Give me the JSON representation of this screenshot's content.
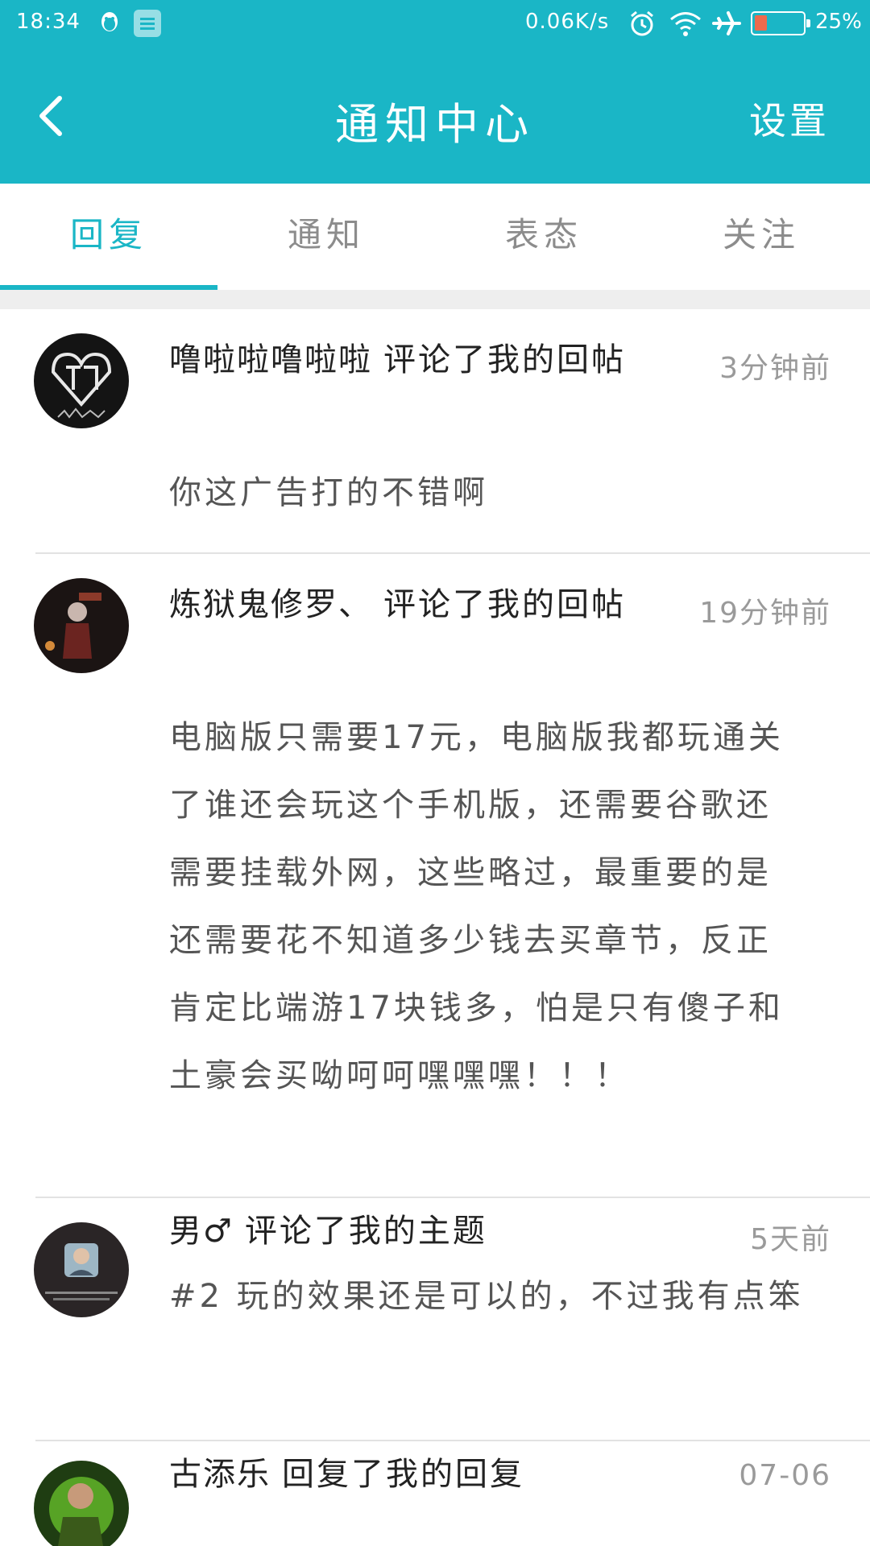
{
  "status_bar": {
    "time": "18:34",
    "net_speed": "0.06K/s",
    "battery_percent": "25%",
    "battery_level": 0.25,
    "icons": [
      "qq-icon",
      "message-icon",
      "alarm-icon",
      "wifi-icon",
      "airplane-icon",
      "battery-icon"
    ]
  },
  "header": {
    "title": "通知中心",
    "settings_label": "设置"
  },
  "tabs": [
    {
      "label": "回复",
      "active": true
    },
    {
      "label": "通知",
      "active": false
    },
    {
      "label": "表态",
      "active": false
    },
    {
      "label": "关注",
      "active": false
    }
  ],
  "notifications": [
    {
      "user": "噜啦啦噜啦啦",
      "action": "评论了我的回帖",
      "time": "3分钟前",
      "content": "你这广告打的不错啊"
    },
    {
      "user": "炼狱鬼修罗、",
      "action": "评论了我的回帖",
      "time": "19分钟前",
      "content": "电脑版只需要17元，电脑版我都玩通关了谁还会玩这个手机版，还需要谷歌还需要挂载外网，这些略过，最重要的是还需要花不知道多少钱去买章节，反正肯定比端游17块钱多，怕是只有傻子和土豪会买呦呵呵嘿嘿嘿！！！"
    },
    {
      "user": "男♂",
      "action": "评论了我的主题",
      "time": "5天前",
      "content": "#2 玩的效果还是可以的，不过我有点笨"
    },
    {
      "user": "古添乐",
      "action": "回复了我的回复",
      "time": "07-06",
      "content": ""
    }
  ],
  "colors": {
    "accent": "#1ab6c6",
    "battery_low": "#ee6a4d",
    "tab_inactive": "#8c8c8c",
    "time_text": "#9a9a9a"
  }
}
